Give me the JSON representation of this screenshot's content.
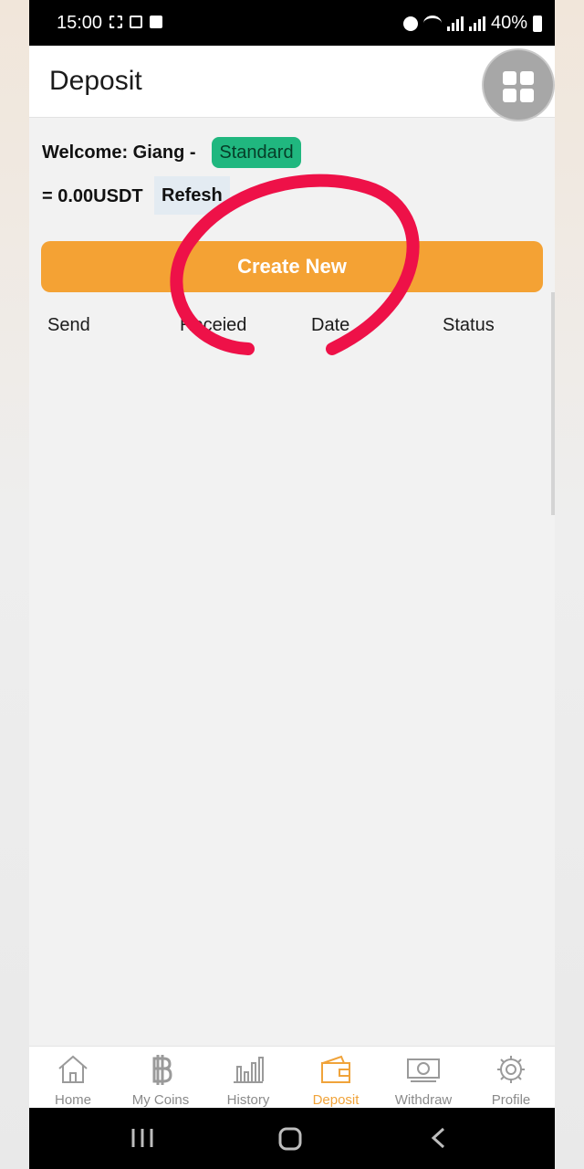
{
  "status_bar": {
    "time": "15:00",
    "battery": "40%"
  },
  "header": {
    "title": "Deposit"
  },
  "account": {
    "welcome": "Welcome: Giang -",
    "tier": "Standard",
    "balance": "= 0.00USDT",
    "refresh_label": "Refesh"
  },
  "actions": {
    "create_new": "Create New"
  },
  "table": {
    "columns": [
      "Send",
      "Receied",
      "Date",
      "Status"
    ],
    "rows": []
  },
  "nav": {
    "items": [
      {
        "label": "Home",
        "icon": "home-icon"
      },
      {
        "label": "My Coins",
        "icon": "bitcoin-icon"
      },
      {
        "label": "History",
        "icon": "bar-chart-icon"
      },
      {
        "label": "Deposit",
        "icon": "wallet-icon",
        "active": true
      },
      {
        "label": "Withdraw",
        "icon": "banknote-icon"
      },
      {
        "label": "Profile",
        "icon": "gear-icon"
      }
    ]
  },
  "colors": {
    "accent": "#f4a234",
    "badge": "#20b77f",
    "active_nav": "#f0a33a",
    "annotation": "#ee1148"
  }
}
